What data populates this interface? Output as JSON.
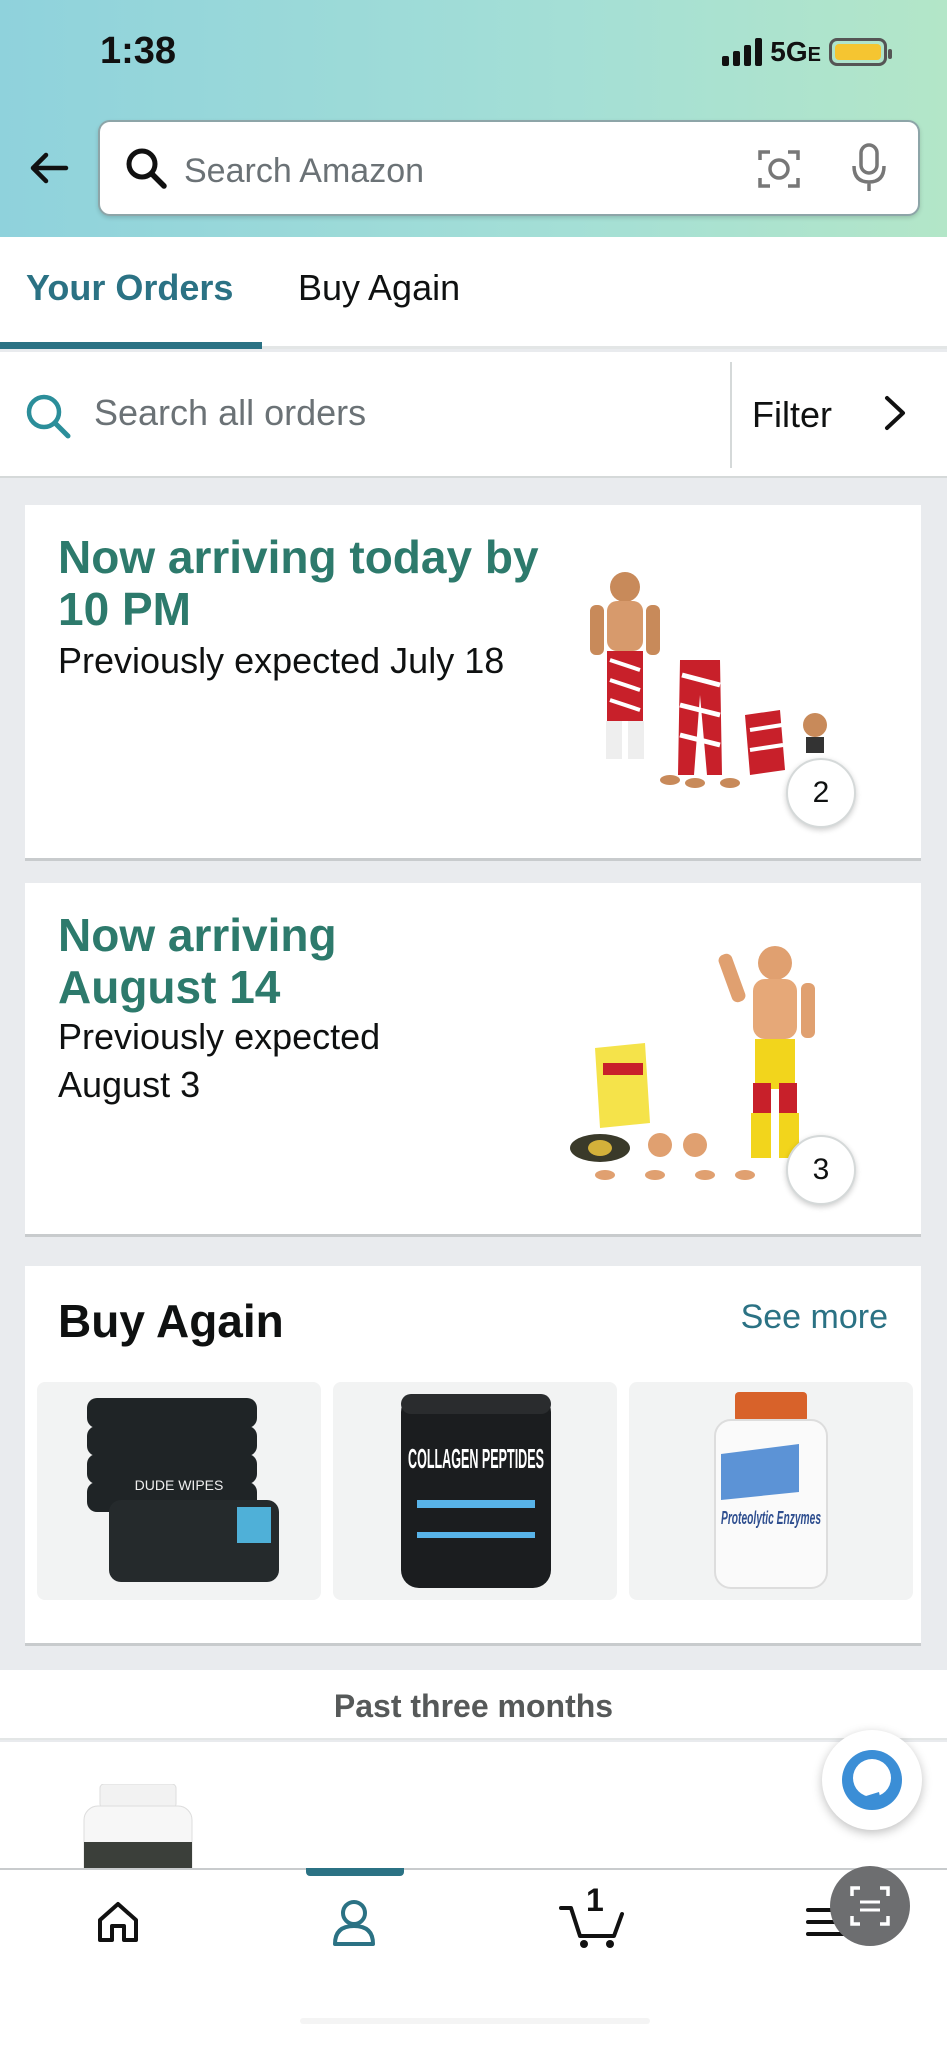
{
  "status_bar": {
    "time": "1:38",
    "network": "5G",
    "network_sub": "E"
  },
  "search": {
    "placeholder": "Search Amazon"
  },
  "tabs": [
    {
      "label": "Your Orders",
      "active": true
    },
    {
      "label": "Buy Again",
      "active": false
    }
  ],
  "orders_search": {
    "placeholder": "Search all orders",
    "filter_label": "Filter"
  },
  "orders": [
    {
      "headline": "Now arriving today by 10 PM",
      "sub": "Previously expected July 18",
      "item_count": "2"
    },
    {
      "headline": "Now arriving August 14",
      "sub": "Previously expected August 3",
      "item_count": "3"
    }
  ],
  "buy_again": {
    "title": "Buy Again",
    "see_more": "See more",
    "products": [
      {
        "label": "DUDE WIPES"
      },
      {
        "label": "COLLAGEN PEPTIDES"
      },
      {
        "label": "Proteolytic Enzymes"
      }
    ]
  },
  "past_section": {
    "label": "Past three months"
  },
  "bottom_nav": {
    "cart_count": "1"
  },
  "colors": {
    "accent": "#2b7284",
    "arrival_green": "#2d7a6c",
    "header_gradient": [
      "#8fd2dc",
      "#b3e6c8"
    ]
  },
  "icons": [
    "back-arrow-icon",
    "search-icon",
    "camera-icon",
    "mic-icon",
    "chevron-right-icon",
    "home-icon",
    "account-icon",
    "cart-icon",
    "menu-icon",
    "alexa-icon",
    "scan-icon"
  ]
}
